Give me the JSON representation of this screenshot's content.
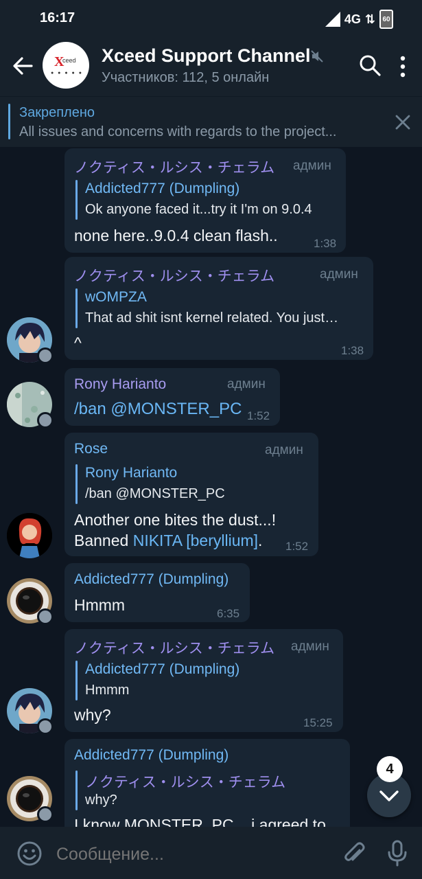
{
  "status_bar": {
    "time": "16:17",
    "network": "4G",
    "battery": "60"
  },
  "header": {
    "title": "Xceed Support Channel",
    "subtitle": "Участников: 112, 5 онлайн",
    "avatar_text": "ceed"
  },
  "pinned": {
    "label": "Закреплено",
    "text": "All issues and concerns with regards to the project..."
  },
  "messages": [
    {
      "sender": "ノクティス・ルシス・チェラム",
      "sender_color": "#9f8fef",
      "role": "админ",
      "reply_name": "Addicted777 (Dumpling)",
      "reply_text": "Ok anyone faced it...try it I'm on 9.0.4",
      "text": "none here..9.0.4 clean flash..",
      "time": "1:38"
    },
    {
      "sender": "ノクティス・ルシス・チェラム",
      "sender_color": "#9f8fef",
      "role": "админ",
      "reply_name": "wOMPZA",
      "reply_text": "That ad shit isnt kernel related. You just…",
      "text": "^",
      "time": "1:38"
    },
    {
      "sender": "Rony Harianto",
      "sender_color": "#a89cf0",
      "role": "админ",
      "text": "/ban @MONSTER_PC",
      "time": "1:52"
    },
    {
      "sender": "Rose",
      "sender_color": "#71b9f5",
      "role": "админ",
      "reply_name": "Rony Harianto",
      "reply_text": "/ban @MONSTER_PC",
      "text_line1": "Another one bites the dust...!",
      "text_line2_prefix": "Banned ",
      "text_line2_link": "NIKITA [beryllium]",
      "text_line2_suffix": ".",
      "time": "1:52"
    },
    {
      "sender": "Addicted777 (Dumpling)",
      "sender_color": "#71b9f5",
      "text": "Hmmm",
      "time": "6:35"
    },
    {
      "sender": "ノクティス・ルシス・チェラム",
      "sender_color": "#9f8fef",
      "role": "админ",
      "reply_name": "Addicted777 (Dumpling)",
      "reply_text": "Hmmm",
      "text": "why?",
      "time": "15:25"
    },
    {
      "sender": "Addicted777 (Dumpling)",
      "sender_color": "#71b9f5",
      "reply_name": "ノクティス・ルシス・チェラム",
      "reply_text": "why?",
      "text": "I know MONSTER_PC....i agreed to"
    }
  ],
  "unread_count": "4",
  "input": {
    "placeholder": "Сообщение..."
  },
  "icons": {
    "back": "arrow-left-icon",
    "mute": "muted-speaker-icon",
    "search": "search-icon",
    "menu": "more-vertical-icon",
    "close": "close-icon",
    "emoji": "emoji-icon",
    "attach": "paperclip-icon",
    "mic": "microphone-icon",
    "scroll": "chevron-down-icon"
  }
}
